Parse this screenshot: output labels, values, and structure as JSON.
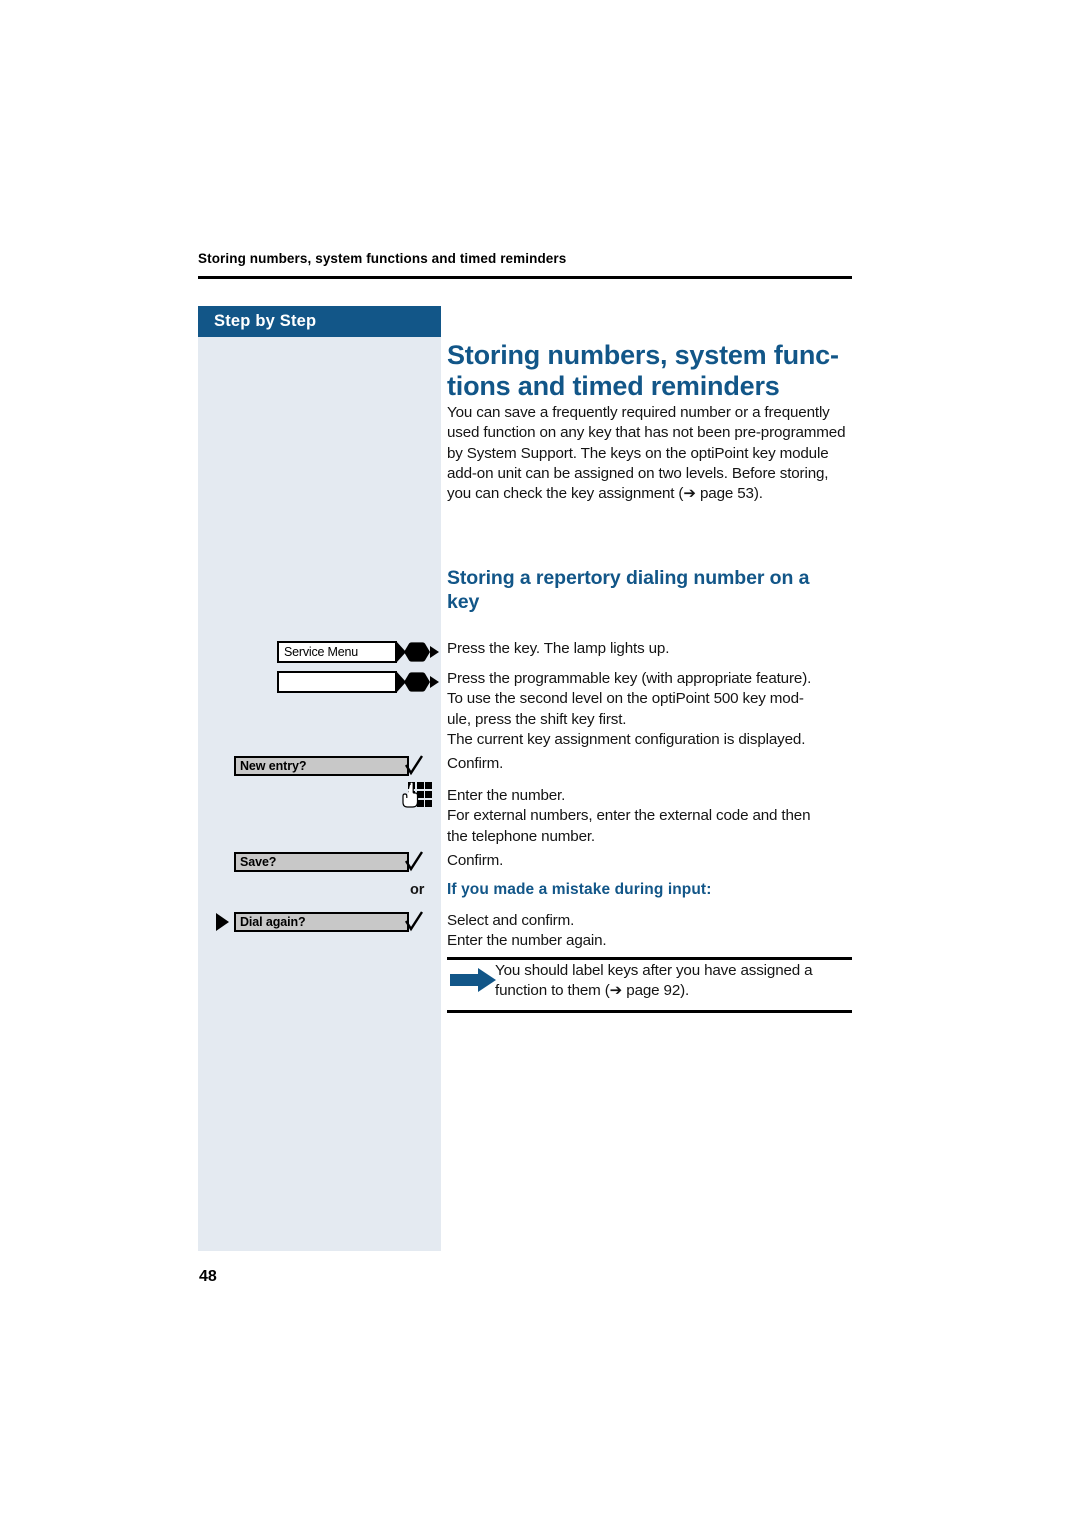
{
  "header": {
    "running_head": "Storing numbers, system functions and timed reminders"
  },
  "sidebar": {
    "label": "Step by Step"
  },
  "main": {
    "title_line1": "Storing numbers, system func-",
    "title_line2": "tions and timed reminders",
    "intro": "You can save a frequently required number or a frequently used function on any key that has not been pre-programmed by System Support. The keys on the optiPoint key module add-on unit can be assigned on two levels. Before storing, you can check the key assignment (➔ page 53).",
    "subtitle_line1": "Storing a repertory dialing number on a",
    "subtitle_line2": "key"
  },
  "steps": [
    {
      "key_label": "Service Menu",
      "instruction": "Press the key. The lamp lights up."
    },
    {
      "key_label": "",
      "instruction_line1": "Press the programmable key (with appropriate feature).",
      "instruction_line2": "To use the second level on the optiPoint 500 key mod-",
      "instruction_line3": "ule, press the shift key first.",
      "instruction_line4": "The current key assignment configuration is displayed."
    },
    {
      "display_label": "New entry?",
      "icon": "checkmark-icon",
      "instruction": "Confirm."
    },
    {
      "icon": "keypad-hand-icon",
      "instruction_line1": "Enter the number.",
      "instruction_line2": "For external numbers, enter the external code and then",
      "instruction_line3": "the telephone number."
    },
    {
      "display_label": "Save?",
      "icon": "checkmark-icon",
      "instruction": "Confirm."
    },
    {
      "or_label": "or",
      "blue_heading": "If you made a mistake during input:"
    },
    {
      "display_label": "Dial again?",
      "icon": "checkmark-icon",
      "marker": "triangle-marker",
      "instruction_line1": "Select and confirm.",
      "instruction_line2": "Enter the number again."
    }
  ],
  "note": {
    "line1": "You should label keys after you have assigned a",
    "line2": "function to them (➔ page 92)."
  },
  "footer": {
    "page_number": "48"
  },
  "colors": {
    "brand_blue": "#125688",
    "sidebar_bg": "#e4eaf1",
    "display_grey": "#c8c8c8"
  }
}
